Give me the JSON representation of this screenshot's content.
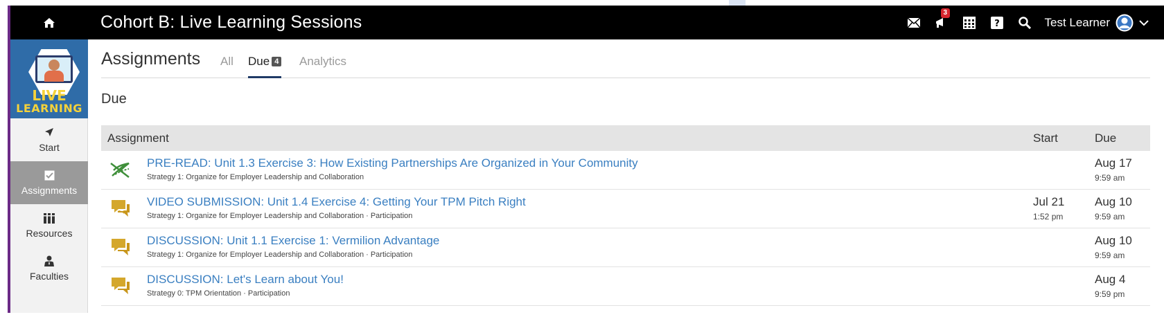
{
  "header": {
    "course_title": "Cohort B: Live Learning Sessions",
    "notification_count": "3",
    "user_name": "Test Learner"
  },
  "sidebar": {
    "logo_line1": "LIVE",
    "logo_line2": "LEARNING",
    "items": [
      {
        "label": "Start",
        "icon": "navigate-arrow-icon"
      },
      {
        "label": "Assignments",
        "icon": "checkbox-icon",
        "active": true
      },
      {
        "label": "Resources",
        "icon": "books-icon"
      },
      {
        "label": "Faculties",
        "icon": "person-icon"
      }
    ]
  },
  "main": {
    "section_title": "Assignments",
    "tabs": [
      {
        "label": "All"
      },
      {
        "label": "Due",
        "count": "4",
        "active": true
      },
      {
        "label": "Analytics"
      }
    ],
    "subhead": "Due",
    "table": {
      "headers": {
        "assignment": "Assignment",
        "start": "Start",
        "due": "Due"
      },
      "rows": [
        {
          "icon": "reading-icon",
          "title": "PRE-READ: Unit 1.3 Exercise 3: How Existing Partnerships Are Organized in Your Community",
          "subtitle": "Strategy 1: Organize for Employer Leadership and Collaboration",
          "start_date": "",
          "start_time": "",
          "due_date": "Aug 17",
          "due_time": "9:59 am"
        },
        {
          "icon": "discussion-bubble-icon",
          "title": "VIDEO SUBMISSION: Unit 1.4 Exercise 4: Getting Your TPM Pitch Right",
          "subtitle": "Strategy 1: Organize for Employer Leadership and Collaboration · Participation",
          "start_date": "Jul 21",
          "start_time": "1:52 pm",
          "due_date": "Aug 10",
          "due_time": "9:59 am"
        },
        {
          "icon": "discussion-bubble-icon",
          "title": "DISCUSSION: Unit 1.1 Exercise 1: Vermilion Advantage",
          "subtitle": "Strategy 1: Organize for Employer Leadership and Collaboration · Participation",
          "start_date": "",
          "start_time": "",
          "due_date": "Aug 10",
          "due_time": "9:59 am"
        },
        {
          "icon": "discussion-bubble-icon",
          "title": "DISCUSSION: Let's Learn about You!",
          "subtitle": "Strategy 0: TPM Orientation · Participation",
          "start_date": "",
          "start_time": "",
          "due_date": "Aug 4",
          "due_time": "9:59 pm"
        }
      ]
    }
  },
  "colors": {
    "link": "#3a7fc1",
    "bubble": "#d4a72c",
    "tab_underline": "#1f3a66",
    "badge": "#d7262e"
  }
}
